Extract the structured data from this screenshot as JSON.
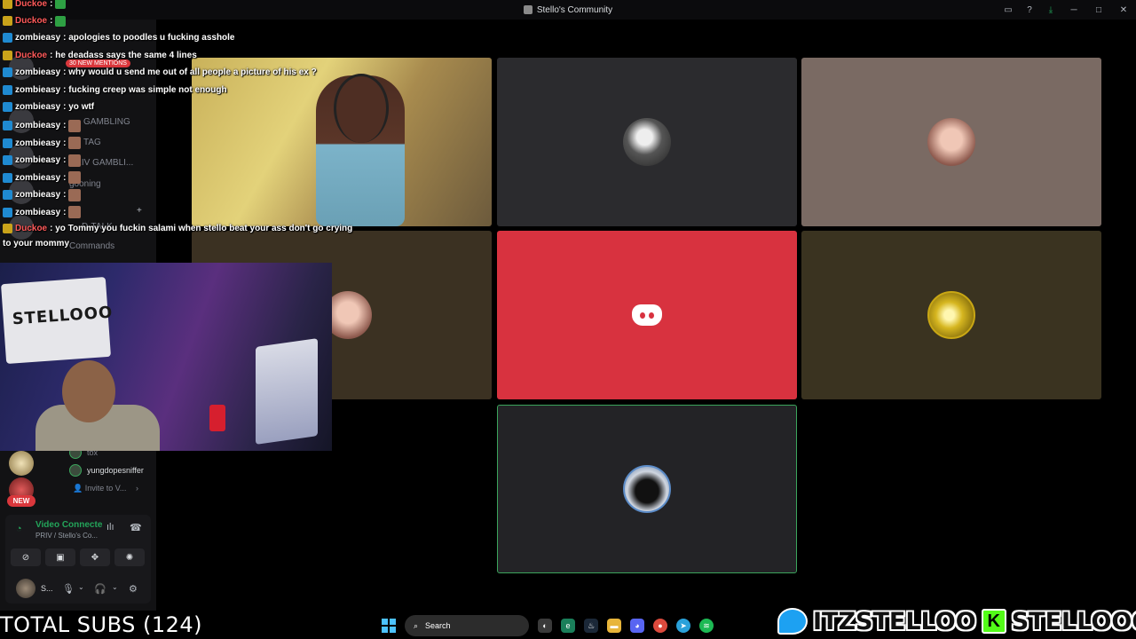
{
  "window": {
    "title": "Stello's Community"
  },
  "chat": {
    "messages": [
      {
        "user": "Duckoe",
        "text": ":",
        "badge": "y",
        "kind": "d"
      },
      {
        "user": "Duckoe",
        "text": ":",
        "badge": "y",
        "kind": "d"
      },
      {
        "user": "zombieasy",
        "text": ": apologies to poodles u fucking asshole",
        "badge": "b",
        "kind": "z"
      },
      {
        "user": "Duckoe",
        "text": ": he deadass says the same 4 lines",
        "badge": "y",
        "kind": "d"
      },
      {
        "user": "zombieasy",
        "text": ": why would u send me out of all people a picture of his ex ?",
        "badge": "b",
        "kind": "z"
      },
      {
        "user": "zombieasy",
        "text": ": fucking creep was simple not enough",
        "badge": "b",
        "kind": "z"
      },
      {
        "user": "zombieasy",
        "text": ": yo wtf",
        "badge": "b",
        "kind": "z"
      },
      {
        "user": "zombieasy",
        "text": ":",
        "badge": "b",
        "kind": "z"
      },
      {
        "user": "zombieasy",
        "text": ":",
        "badge": "b",
        "kind": "z"
      },
      {
        "user": "zombieasy",
        "text": ":",
        "badge": "b",
        "kind": "z"
      },
      {
        "user": "zombieasy",
        "text": ":",
        "badge": "b",
        "kind": "z"
      },
      {
        "user": "zombieasy",
        "text": ":",
        "badge": "b",
        "kind": "z"
      },
      {
        "user": "zombieasy",
        "text": ":",
        "badge": "b",
        "kind": "z"
      },
      {
        "user": "Duckoe",
        "text": ": yo Tommy you fuckin salami when stello beat your ass don't go crying",
        "badge": "y",
        "kind": "d"
      }
    ],
    "wrap_line": "to your mommy"
  },
  "sidebar": {
    "mentions_badge": "30 NEW MENTIONS",
    "channels": [
      "GAMBLING",
      "TAG",
      "PRIV GAMBLI...",
      "gooning",
      "D-TALK",
      "Commands"
    ],
    "new_badge": "NEW",
    "voice_members": [
      "tox",
      "yungdopesniffer"
    ],
    "invite_label": "Invite to V..."
  },
  "voice": {
    "status": "Video Connecte",
    "location": "PRIV / Stello's Co...",
    "user_name": "S..."
  },
  "overlay": {
    "total_subs": "TOTAL SUBS (124)",
    "twitter_handle": "ITZSTELLOO",
    "kick_handle": "STELLOOO",
    "kick_letter": "K",
    "webcam_banner": "STELLOOO"
  },
  "taskbar": {
    "search_placeholder": "Search"
  },
  "colors": {
    "accent_green": "#23a55a",
    "discord_red": "#d8323f",
    "speaking_border": "#3ba55c"
  }
}
